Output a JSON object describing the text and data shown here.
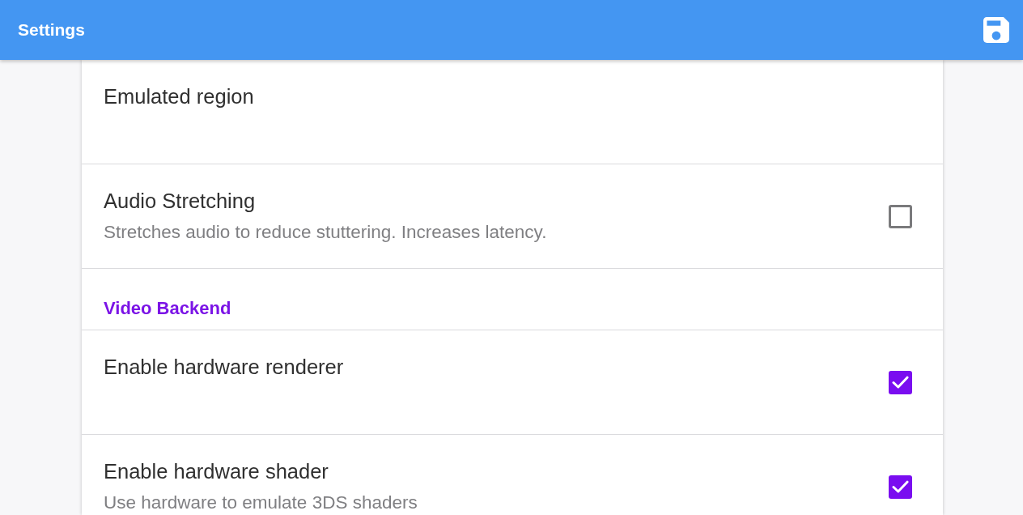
{
  "app_bar": {
    "title": "Settings"
  },
  "settings": [
    {
      "kind": "option",
      "title": "Emulated region"
    },
    {
      "kind": "checkbox",
      "title": "Audio Stretching",
      "description": "Stretches audio to reduce stuttering. Increases latency.",
      "checked": false
    },
    {
      "kind": "section",
      "title": "Video Backend"
    },
    {
      "kind": "checkbox",
      "title": "Enable hardware renderer",
      "checked": true
    },
    {
      "kind": "checkbox",
      "title": "Enable hardware shader",
      "description": "Use hardware to emulate 3DS shaders",
      "checked": true
    }
  ]
}
